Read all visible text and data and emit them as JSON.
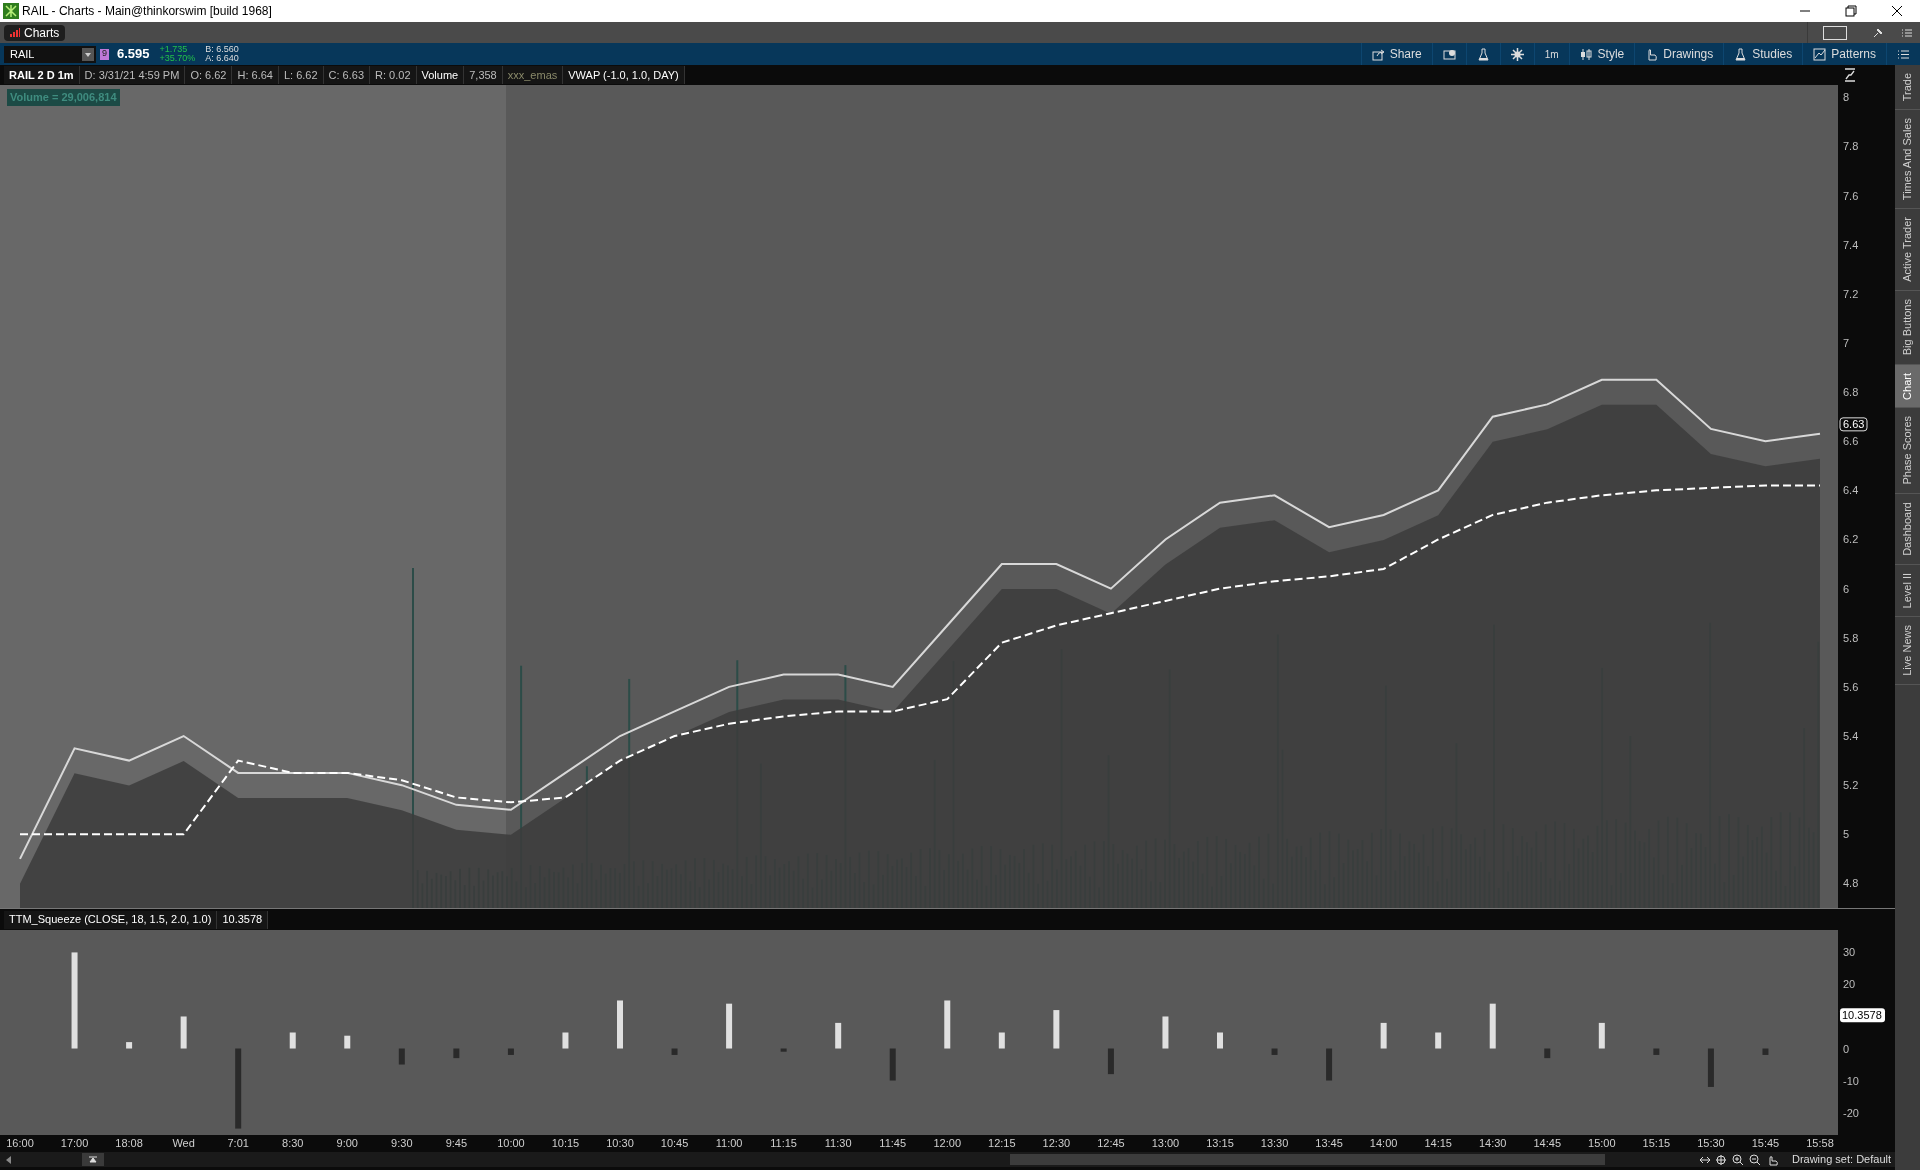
{
  "window": {
    "title": "RAIL - Charts -  Main@thinkorswim [build 1968]"
  },
  "app_tabs": [
    {
      "label": "Charts",
      "selected": true
    }
  ],
  "symbol_bar": {
    "symbol": "RAIL",
    "link_badge": "9",
    "last": "6.595",
    "change": "+1.735",
    "change_pct": "+35.70%",
    "bid": "B: 6.560",
    "ask": "A: 6.640"
  },
  "toolbar": [
    {
      "label": "Share",
      "kind": "share"
    },
    {
      "kind": "alert"
    },
    {
      "kind": "flask"
    },
    {
      "kind": "gear"
    },
    {
      "label": "1m",
      "kind": "text"
    },
    {
      "label": "Style",
      "kind": "style"
    },
    {
      "label": "Drawings",
      "kind": "hand"
    },
    {
      "label": "Studies",
      "kind": "flask"
    },
    {
      "label": "Patterns",
      "kind": "patterns"
    },
    {
      "kind": "menu"
    }
  ],
  "info_bar": [
    {
      "text": "RAIL 2 D 1m",
      "kind": "title"
    },
    {
      "text": "D: 3/31/21 4:59 PM",
      "kind": "field"
    },
    {
      "text": "O: 6.62",
      "kind": "field"
    },
    {
      "text": "H: 6.64",
      "kind": "field"
    },
    {
      "text": "L: 6.62",
      "kind": "field"
    },
    {
      "text": "C: 6.63",
      "kind": "field"
    },
    {
      "text": "R: 0.02",
      "kind": "field"
    },
    {
      "text": "Volume",
      "kind": "study"
    },
    {
      "text": "7,358",
      "kind": "field"
    },
    {
      "text": "xxx_emas",
      "kind": "dim"
    },
    {
      "text": "VWAP (-1.0, 1.0, DAY)",
      "kind": "study"
    }
  ],
  "volume_label": "Volume = 29,006,814",
  "price_chart": {
    "current_price": "6.63",
    "chart_data": {
      "type": "line",
      "ylim": [
        4.7,
        8.05
      ],
      "yticks": [
        4.8,
        5,
        5.2,
        5.4,
        5.6,
        5.8,
        6,
        6.2,
        6.4,
        6.6,
        6.8,
        7,
        7.2,
        7.4,
        7.6,
        7.8,
        8
      ],
      "series": [
        {
          "color": "#d8d8d8",
          "values": [
            4.9,
            5.35,
            5.3,
            5.4,
            5.25,
            5.25,
            5.25,
            5.2,
            5.12,
            5.1,
            5.25,
            5.4,
            5.5,
            5.6,
            5.65,
            5.65,
            5.6,
            5.85,
            6.1,
            6.1,
            6.0,
            6.2,
            6.35,
            6.38,
            6.25,
            6.3,
            6.4,
            6.7,
            6.75,
            6.85,
            6.85,
            6.65,
            6.6,
            6.63
          ]
        },
        {
          "color": "#ffffff",
          "line_style": "dashed",
          "values": [
            5.0,
            5.0,
            5.0,
            5.0,
            5.3,
            5.25,
            5.25,
            5.22,
            5.15,
            5.13,
            5.15,
            5.3,
            5.4,
            5.45,
            5.48,
            5.5,
            5.5,
            5.55,
            5.78,
            5.85,
            5.9,
            5.95,
            6.0,
            6.03,
            6.05,
            6.08,
            6.2,
            6.3,
            6.35,
            6.38,
            6.4,
            6.41,
            6.42,
            6.42
          ]
        }
      ]
    }
  },
  "study_bar": [
    "TTM_Squeeze (CLOSE, 18, 1.5, 2.0, 1.0)",
    "10.3578"
  ],
  "squeeze_chart": {
    "current_value": "10.3578",
    "chart_data": {
      "type": "bar",
      "categories": [
        "16:00",
        "17:00",
        "18:08",
        "Wed",
        "7:01",
        "8:30",
        "9:00",
        "9:30",
        "9:45",
        "10:00",
        "10:15",
        "10:30",
        "10:45",
        "11:00",
        "11:15",
        "11:30",
        "11:45",
        "12:00",
        "12:15",
        "12:30",
        "12:45",
        "13:00",
        "13:15",
        "13:30",
        "13:45",
        "14:00",
        "14:15",
        "14:30",
        "14:45",
        "15:00",
        "15:15",
        "15:30",
        "15:45",
        "15:58"
      ],
      "ylim": [
        -27,
        37
      ],
      "yticks": [
        -20,
        -10,
        0,
        20,
        30
      ],
      "series": [
        {
          "color": "#e0e0e0",
          "values": [
            null,
            30,
            2,
            10,
            null,
            5,
            4,
            null,
            null,
            null,
            5,
            15,
            null,
            14,
            null,
            8,
            null,
            15,
            5,
            12,
            null,
            10,
            5,
            null,
            null,
            8,
            5,
            14,
            null,
            8,
            null,
            null,
            null,
            null
          ]
        },
        {
          "color": "#2a2a2a",
          "values": [
            null,
            null,
            null,
            null,
            -25,
            null,
            null,
            -5,
            -3,
            -2,
            null,
            null,
            -2,
            null,
            -1,
            null,
            -10,
            null,
            null,
            null,
            -8,
            null,
            null,
            -2,
            -10,
            null,
            null,
            null,
            -3,
            null,
            -2,
            -12,
            -2,
            null
          ]
        }
      ]
    }
  },
  "side_tabs": [
    {
      "label": "Trade",
      "selected": false
    },
    {
      "label": "Times And Sales",
      "selected": false
    },
    {
      "label": "Active Trader",
      "selected": false
    },
    {
      "label": "Big Buttons",
      "selected": false
    },
    {
      "label": "Chart",
      "selected": true
    },
    {
      "label": "Phase Scores",
      "selected": false
    },
    {
      "label": "Dashboard",
      "selected": false
    },
    {
      "label": "Level II",
      "selected": false
    },
    {
      "label": "Live News",
      "selected": false
    }
  ],
  "status": {
    "drawing_set": "Drawing set: Default"
  }
}
